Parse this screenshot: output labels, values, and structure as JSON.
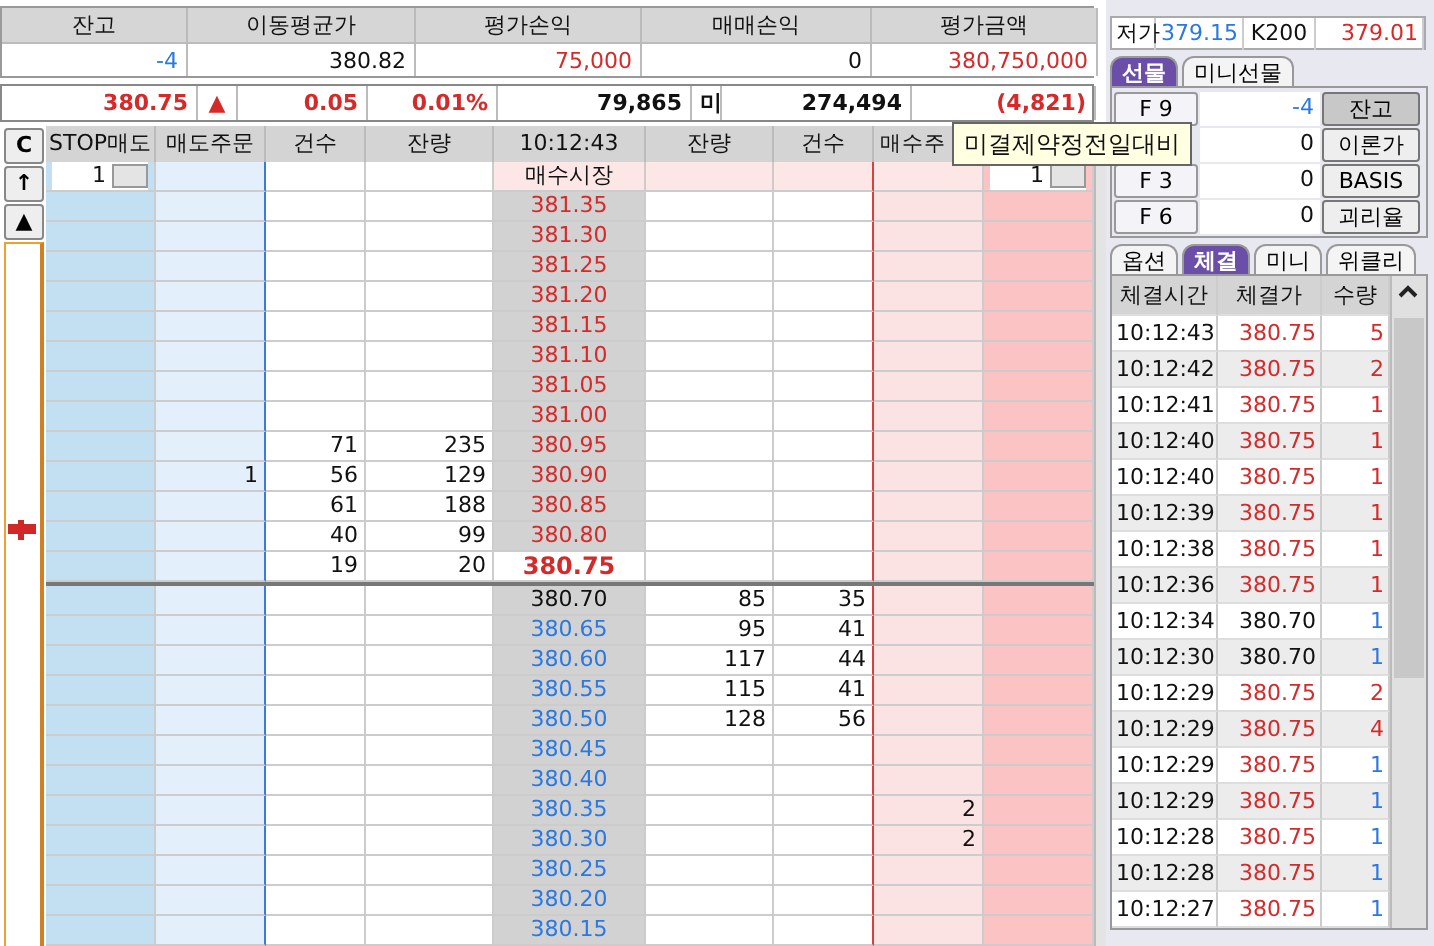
{
  "balance_table": {
    "columns": [
      "잔고",
      "이동평균가",
      "평가손익",
      "매매손익",
      "평가금액"
    ],
    "values": [
      {
        "text": "-4",
        "color": "#2a78e0"
      },
      {
        "text": "380.82",
        "color": "#111111"
      },
      {
        "text": "75,000",
        "color": "#d42a2a"
      },
      {
        "text": "0",
        "color": "#111111"
      },
      {
        "text": "380,750,000",
        "color": "#d42a2a"
      }
    ]
  },
  "summary": {
    "price": "380.75",
    "arrow": "▲",
    "change": "0.05",
    "rate": "0.01%",
    "volume": "79,865",
    "oi_label": "미",
    "open_interest": "274,494",
    "oi_change": "(4,821)"
  },
  "side_buttons": [
    "C",
    "↑",
    "▲"
  ],
  "order_book": {
    "columns": [
      "STOP매도",
      "매도주문",
      "건수",
      "잔량",
      "10:12:43",
      "잔량",
      "건수",
      "매수주"
    ],
    "stop_sell_spin": "1",
    "market_label": "매수시장",
    "stop_buy_spin": "1",
    "rows": [
      {
        "price": "381.35",
        "color": "#d42a2a",
        "current": false
      },
      {
        "price": "381.30",
        "color": "#d42a2a",
        "current": false
      },
      {
        "price": "381.25",
        "color": "#d42a2a",
        "current": false
      },
      {
        "price": "381.20",
        "color": "#d42a2a",
        "current": false
      },
      {
        "price": "381.15",
        "color": "#d42a2a",
        "current": false
      },
      {
        "price": "381.10",
        "color": "#d42a2a",
        "current": false
      },
      {
        "price": "381.05",
        "color": "#d42a2a",
        "current": false
      },
      {
        "price": "381.00",
        "color": "#d42a2a",
        "current": false
      },
      {
        "price": "380.95",
        "color": "#d42a2a",
        "current": false,
        "sell_count": "71",
        "sell_qty": "235"
      },
      {
        "price": "380.90",
        "color": "#d42a2a",
        "current": false,
        "sell_order": "1",
        "sell_count": "56",
        "sell_qty": "129"
      },
      {
        "price": "380.85",
        "color": "#d42a2a",
        "current": false,
        "sell_count": "61",
        "sell_qty": "188"
      },
      {
        "price": "380.80",
        "color": "#d42a2a",
        "current": false,
        "sell_count": "40",
        "sell_qty": "99"
      },
      {
        "price": "380.75",
        "color": "#d42a2a",
        "current": true,
        "sell_count": "19",
        "sell_qty": "20"
      },
      {
        "price": "380.70",
        "color": "#111111",
        "current": false,
        "buy_qty": "85",
        "buy_count": "35"
      },
      {
        "price": "380.65",
        "color": "#2a78e0",
        "current": false,
        "buy_qty": "95",
        "buy_count": "41"
      },
      {
        "price": "380.60",
        "color": "#2a78e0",
        "current": false,
        "buy_qty": "117",
        "buy_count": "44"
      },
      {
        "price": "380.55",
        "color": "#2a78e0",
        "current": false,
        "buy_qty": "115",
        "buy_count": "41"
      },
      {
        "price": "380.50",
        "color": "#2a78e0",
        "current": false,
        "buy_qty": "128",
        "buy_count": "56"
      },
      {
        "price": "380.45",
        "color": "#2a78e0",
        "current": false
      },
      {
        "price": "380.40",
        "color": "#2a78e0",
        "current": false
      },
      {
        "price": "380.35",
        "color": "#2a78e0",
        "current": false,
        "buy_order": "2"
      },
      {
        "price": "380.30",
        "color": "#2a78e0",
        "current": false,
        "buy_order": "2"
      },
      {
        "price": "380.25",
        "color": "#2a78e0",
        "current": false
      },
      {
        "price": "380.20",
        "color": "#2a78e0",
        "current": false
      },
      {
        "price": "380.15",
        "color": "#2a78e0",
        "current": false
      }
    ]
  },
  "tooltip": "미결제약정전일대비",
  "quote": {
    "low_label": "저가",
    "low": "379.15",
    "index_label": "K200",
    "index": "379.01"
  },
  "futures_tabs": [
    {
      "label": "선물",
      "selected": true
    },
    {
      "label": "미니선물",
      "selected": false
    }
  ],
  "futures_rows": [
    {
      "code": "F 9",
      "value": "-4",
      "color": "#2a78e0",
      "action": "잔고",
      "selected": true
    },
    {
      "value": "0",
      "color": "#111111",
      "action": "이론가",
      "selected": false
    },
    {
      "code": "F 3",
      "value": "0",
      "color": "#111111",
      "action": "BASIS",
      "selected": false
    },
    {
      "code": "F 6",
      "value": "0",
      "color": "#111111",
      "action": "괴리율",
      "selected": false
    }
  ],
  "trade_tabs": [
    {
      "label": "옵션",
      "selected": false
    },
    {
      "label": "체결",
      "selected": true
    },
    {
      "label": "미니",
      "selected": false
    },
    {
      "label": "위클리",
      "selected": false
    }
  ],
  "trades": {
    "columns": [
      "체결시간",
      "체결가",
      "수량"
    ],
    "rows": [
      {
        "time": "10:12:43",
        "price": {
          "text": "380.75",
          "color": "#d42a2a"
        },
        "qty": {
          "text": "5",
          "color": "#d42a2a"
        }
      },
      {
        "time": "10:12:42",
        "price": {
          "text": "380.75",
          "color": "#d42a2a"
        },
        "qty": {
          "text": "2",
          "color": "#d42a2a"
        }
      },
      {
        "time": "10:12:41",
        "price": {
          "text": "380.75",
          "color": "#d42a2a"
        },
        "qty": {
          "text": "1",
          "color": "#d42a2a"
        }
      },
      {
        "time": "10:12:40",
        "price": {
          "text": "380.75",
          "color": "#d42a2a"
        },
        "qty": {
          "text": "1",
          "color": "#d42a2a"
        }
      },
      {
        "time": "10:12:40",
        "price": {
          "text": "380.75",
          "color": "#d42a2a"
        },
        "qty": {
          "text": "1",
          "color": "#d42a2a"
        }
      },
      {
        "time": "10:12:39",
        "price": {
          "text": "380.75",
          "color": "#d42a2a"
        },
        "qty": {
          "text": "1",
          "color": "#d42a2a"
        }
      },
      {
        "time": "10:12:38",
        "price": {
          "text": "380.75",
          "color": "#d42a2a"
        },
        "qty": {
          "text": "1",
          "color": "#d42a2a"
        }
      },
      {
        "time": "10:12:36",
        "price": {
          "text": "380.75",
          "color": "#d42a2a"
        },
        "qty": {
          "text": "1",
          "color": "#d42a2a"
        }
      },
      {
        "time": "10:12:34",
        "price": {
          "text": "380.70",
          "color": "#111111"
        },
        "qty": {
          "text": "1",
          "color": "#2a78e0"
        }
      },
      {
        "time": "10:12:30",
        "price": {
          "text": "380.70",
          "color": "#111111"
        },
        "qty": {
          "text": "1",
          "color": "#2a78e0"
        }
      },
      {
        "time": "10:12:29",
        "price": {
          "text": "380.75",
          "color": "#d42a2a"
        },
        "qty": {
          "text": "2",
          "color": "#d42a2a"
        }
      },
      {
        "time": "10:12:29",
        "price": {
          "text": "380.75",
          "color": "#d42a2a"
        },
        "qty": {
          "text": "4",
          "color": "#d42a2a"
        }
      },
      {
        "time": "10:12:29",
        "price": {
          "text": "380.75",
          "color": "#d42a2a"
        },
        "qty": {
          "text": "1",
          "color": "#2a78e0"
        }
      },
      {
        "time": "10:12:29",
        "price": {
          "text": "380.75",
          "color": "#d42a2a"
        },
        "qty": {
          "text": "1",
          "color": "#2a78e0"
        }
      },
      {
        "time": "10:12:28",
        "price": {
          "text": "380.75",
          "color": "#d42a2a"
        },
        "qty": {
          "text": "1",
          "color": "#2a78e0"
        }
      },
      {
        "time": "10:12:28",
        "price": {
          "text": "380.75",
          "color": "#d42a2a"
        },
        "qty": {
          "text": "1",
          "color": "#2a78e0"
        }
      },
      {
        "time": "10:12:27",
        "price": {
          "text": "380.75",
          "color": "#d42a2a"
        },
        "qty": {
          "text": "1",
          "color": "#2a78e0"
        }
      }
    ]
  }
}
